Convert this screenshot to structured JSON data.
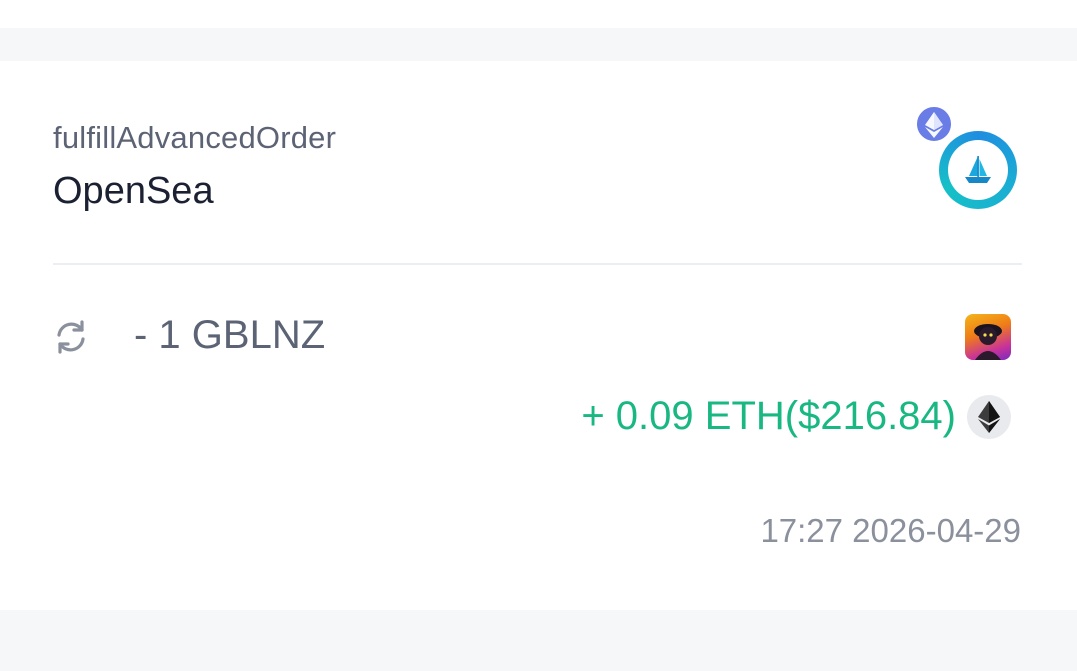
{
  "transaction": {
    "method": "fulfillAdvancedOrder",
    "app_name": "OpenSea",
    "dapp_icon": "opensea-logo-icon",
    "chain_icon": "ethereum-chain-badge-icon",
    "sent": {
      "icon": "refresh-icon",
      "amount_text": "- 1 GBLNZ",
      "token_icon": "gblnz-nft-icon"
    },
    "received": {
      "amount_text": "+ 0.09 ETH($216.84)",
      "token_icon": "eth-token-icon"
    },
    "timestamp": "17:27 2026-04-29"
  },
  "colors": {
    "positive": "#19b882",
    "muted_text": "#5b6375",
    "primary_text": "#1b2132",
    "timestamp": "#8a909c",
    "section_bg": "#f6f7f9"
  }
}
